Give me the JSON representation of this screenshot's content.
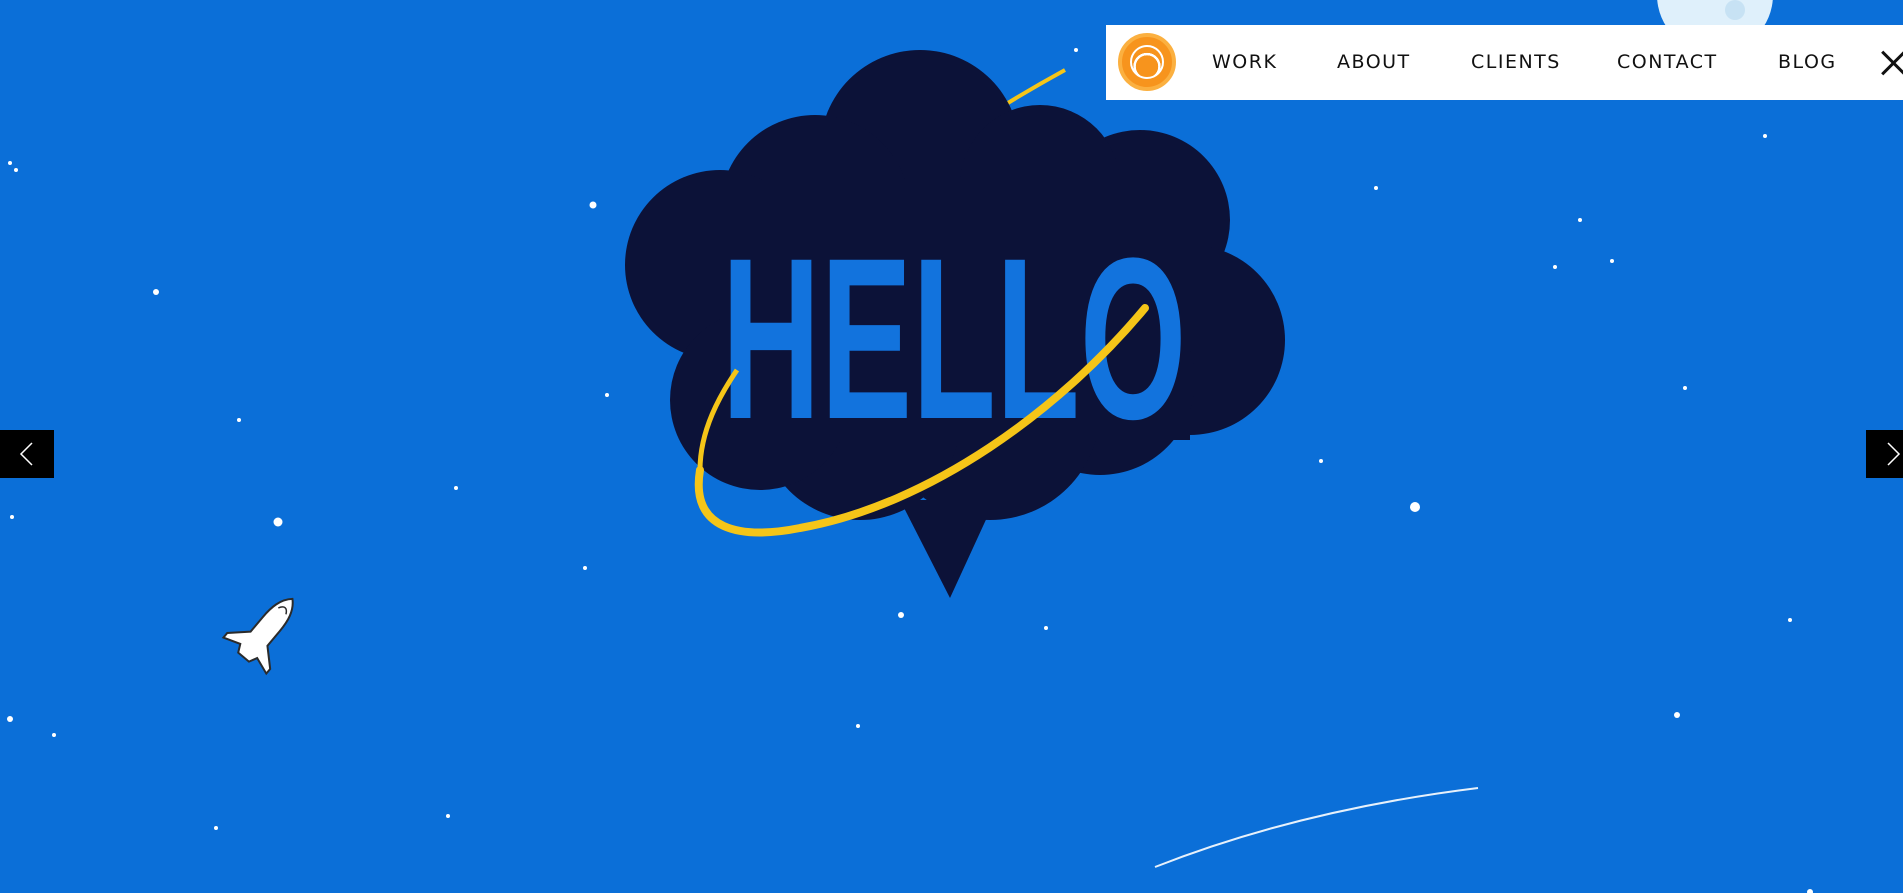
{
  "hero": {
    "headline": "HELLO"
  },
  "nav": {
    "logo_icon": "sun-logo-icon",
    "items": [
      {
        "label": "WORK"
      },
      {
        "label": "ABOUT"
      },
      {
        "label": "CLIENTS"
      },
      {
        "label": "CONTACT"
      },
      {
        "label": "BLOG"
      }
    ],
    "close_icon": "close-icon"
  },
  "slider": {
    "prev_icon": "chevron-left-icon",
    "next_icon": "chevron-right-icon"
  },
  "colors": {
    "background": "#0b6fd8",
    "cloud": "#0c1238",
    "headline": "#1273dd",
    "orbit": "#f5c518",
    "logo": "#f7941d",
    "navbar": "#ffffff"
  }
}
